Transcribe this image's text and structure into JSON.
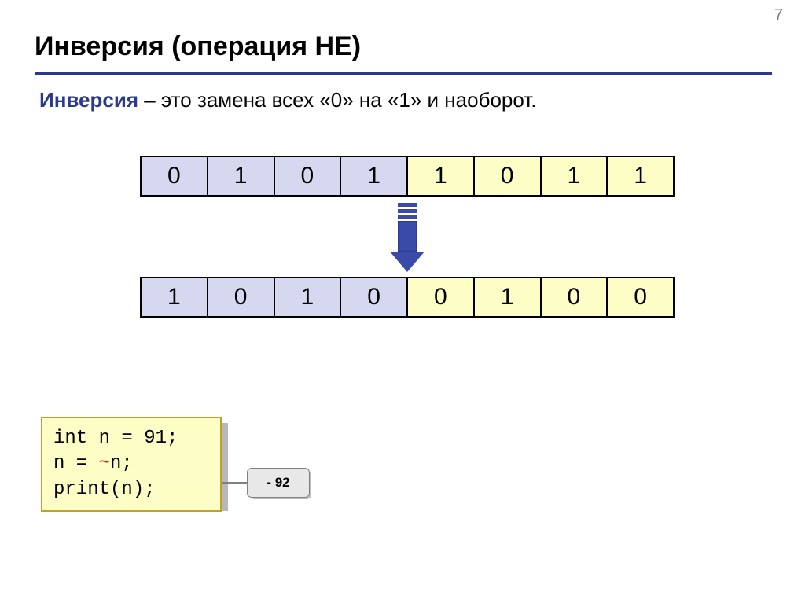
{
  "page_number": "7",
  "title": "Инверсия (операция НЕ)",
  "definition": {
    "term": "Инверсия",
    "rest": " – это замена всех «0» на «1» и наоборот."
  },
  "bits_before": [
    "0",
    "1",
    "0",
    "1",
    "1",
    "0",
    "1",
    "1"
  ],
  "bits_after": [
    "1",
    "0",
    "1",
    "0",
    "0",
    "1",
    "0",
    "0"
  ],
  "bit_colors_first_half": "lav",
  "bit_colors_second_half": "yel",
  "code": {
    "line1": "int n = 91;",
    "line2a": "n = ",
    "line2b": "~",
    "line2c": "n;",
    "line3": "print(n);"
  },
  "result": "- 92"
}
